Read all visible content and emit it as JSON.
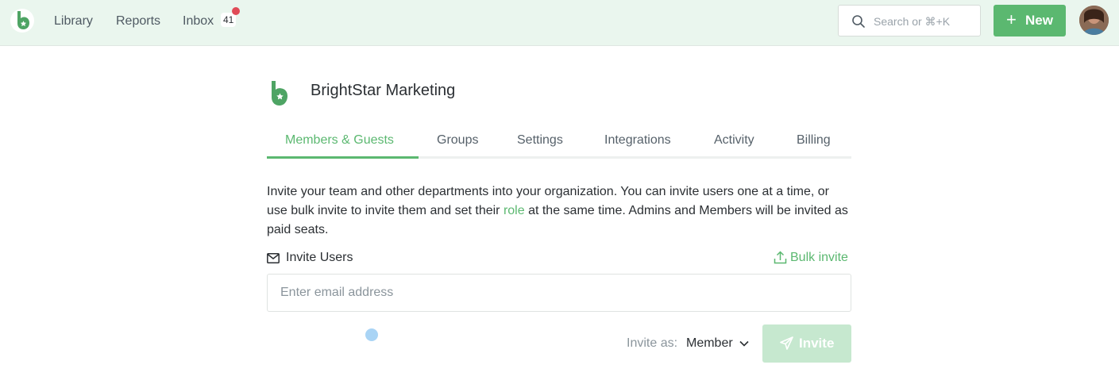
{
  "nav": {
    "links": [
      "Library",
      "Reports",
      "Inbox"
    ],
    "inbox_count": "41",
    "search_placeholder": "Search or ⌘+K",
    "new_label": "New"
  },
  "org": {
    "name": "BrightStar Marketing"
  },
  "tabs": [
    "Members & Guests",
    "Groups",
    "Settings",
    "Integrations",
    "Activity",
    "Billing"
  ],
  "active_tab": "Members & Guests",
  "description": {
    "before": "Invite your team and other departments into your organization. You can invite users one at a time, or use bulk invite to invite them and set their ",
    "link": "role",
    "after": " at the same time. Admins and Members will be invited as paid seats."
  },
  "invite": {
    "section_label": "Invite Users",
    "bulk_label": "Bulk invite",
    "email_placeholder": "Enter email address",
    "invite_as_label": "Invite as:",
    "role_value": "Member",
    "button_label": "Invite"
  },
  "colors": {
    "accent": "#5bb870",
    "topbar": "#eaf6ee",
    "badge_dot": "#e04b57"
  }
}
